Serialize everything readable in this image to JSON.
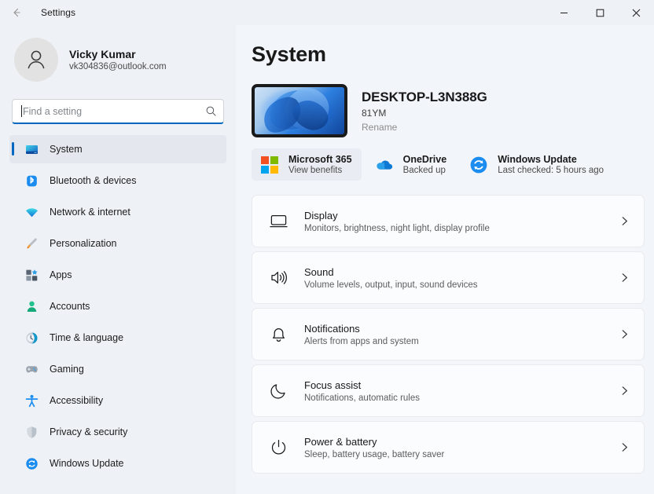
{
  "titlebar": {
    "back_icon": "back-arrow-icon",
    "title": "Settings",
    "minimize": "minimize-icon",
    "maximize": "maximize-icon",
    "close": "close-icon"
  },
  "account": {
    "avatar_icon": "person-avatar-icon",
    "name": "Vicky Kumar",
    "email": "vk304836@outlook.com"
  },
  "search": {
    "placeholder": "Find a setting",
    "value": "",
    "icon": "search-icon"
  },
  "sidebar": {
    "items": [
      {
        "label": "System",
        "icon": "monitor-icon",
        "selected": true
      },
      {
        "label": "Bluetooth & devices",
        "icon": "bluetooth-icon",
        "selected": false
      },
      {
        "label": "Network & internet",
        "icon": "wifi-icon",
        "selected": false
      },
      {
        "label": "Personalization",
        "icon": "paintbrush-icon",
        "selected": false
      },
      {
        "label": "Apps",
        "icon": "apps-grid-icon",
        "selected": false
      },
      {
        "label": "Accounts",
        "icon": "person-icon",
        "selected": false
      },
      {
        "label": "Time & language",
        "icon": "clock-icon",
        "selected": false
      },
      {
        "label": "Gaming",
        "icon": "gamepad-icon",
        "selected": false
      },
      {
        "label": "Accessibility",
        "icon": "accessibility-person-icon",
        "selected": false
      },
      {
        "label": "Privacy & security",
        "icon": "shield-icon",
        "selected": false
      },
      {
        "label": "Windows Update",
        "icon": "refresh-icon",
        "selected": false
      }
    ]
  },
  "main": {
    "page_title": "System",
    "device": {
      "thumbnail_icon": "windows-bloom-wallpaper-thumbnail",
      "name": "DESKTOP-L3N388G",
      "model": "81YM",
      "rename_label": "Rename"
    },
    "quicklinks": [
      {
        "title": "Microsoft 365",
        "sub": "View benefits",
        "icon": "microsoft-logo-icon",
        "hover": true
      },
      {
        "title": "OneDrive",
        "sub": "Backed up",
        "icon": "onedrive-cloud-icon",
        "hover": false
      },
      {
        "title": "Windows Update",
        "sub": "Last checked: 5 hours ago",
        "icon": "refresh-icon",
        "hover": false
      }
    ],
    "cards": [
      {
        "title": "Display",
        "sub": "Monitors, brightness, night light, display profile",
        "icon": "monitor-outline-icon"
      },
      {
        "title": "Sound",
        "sub": "Volume levels, output, input, sound devices",
        "icon": "speaker-icon"
      },
      {
        "title": "Notifications",
        "sub": "Alerts from apps and system",
        "icon": "bell-icon"
      },
      {
        "title": "Focus assist",
        "sub": "Notifications, automatic rules",
        "icon": "moon-icon"
      },
      {
        "title": "Power & battery",
        "sub": "Sleep, battery usage, battery saver",
        "icon": "power-icon"
      }
    ]
  },
  "colors": {
    "accent": "#0067c0",
    "window_bg": "#eef2f7",
    "content_bg": "#f2f5f9",
    "card_bg": "#fbfcfe"
  }
}
